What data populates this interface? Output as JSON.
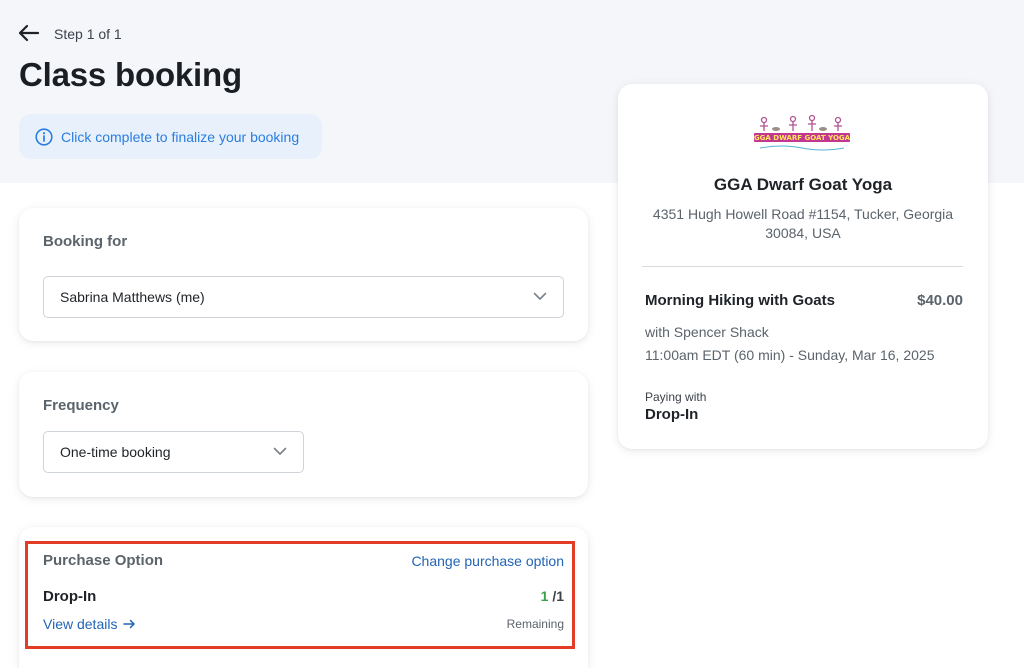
{
  "header": {
    "step_label": "Step 1 of 1",
    "title": "Class booking",
    "info_banner": "Click complete to finalize your booking"
  },
  "booking_for": {
    "label": "Booking for",
    "selected": "Sabrina Matthews (me)"
  },
  "frequency": {
    "label": "Frequency",
    "selected": "One-time booking"
  },
  "purchase_option": {
    "label": "Purchase Option",
    "change_link": "Change purchase option",
    "option_name": "Drop-In",
    "remaining_count": "1",
    "remaining_total": "/1",
    "remaining_label": "Remaining",
    "view_details": "View details"
  },
  "summary": {
    "logo_text": "GGA DWARF GOAT YOGA",
    "business_name": "GGA Dwarf Goat Yoga",
    "address": "4351 Hugh Howell Road #1154, Tucker, Georgia 30084, USA",
    "class_name": "Morning Hiking with Goats",
    "price": "$40.00",
    "instructor": "with Spencer Shack",
    "datetime": "11:00am EDT (60 min) - Sunday, Mar 16, 2025",
    "paying_with_label": "Paying with",
    "paying_with_value": "Drop-In"
  },
  "icons": {
    "back": "arrow-left-icon",
    "info": "info-circle-icon",
    "chevron": "chevron-down-icon",
    "arrow_right": "arrow-right-icon"
  },
  "colors": {
    "accent_blue": "#2264b6",
    "info_blue": "#2a7de1",
    "highlight_red": "#e23c26",
    "remaining_green": "#3aa14a"
  }
}
